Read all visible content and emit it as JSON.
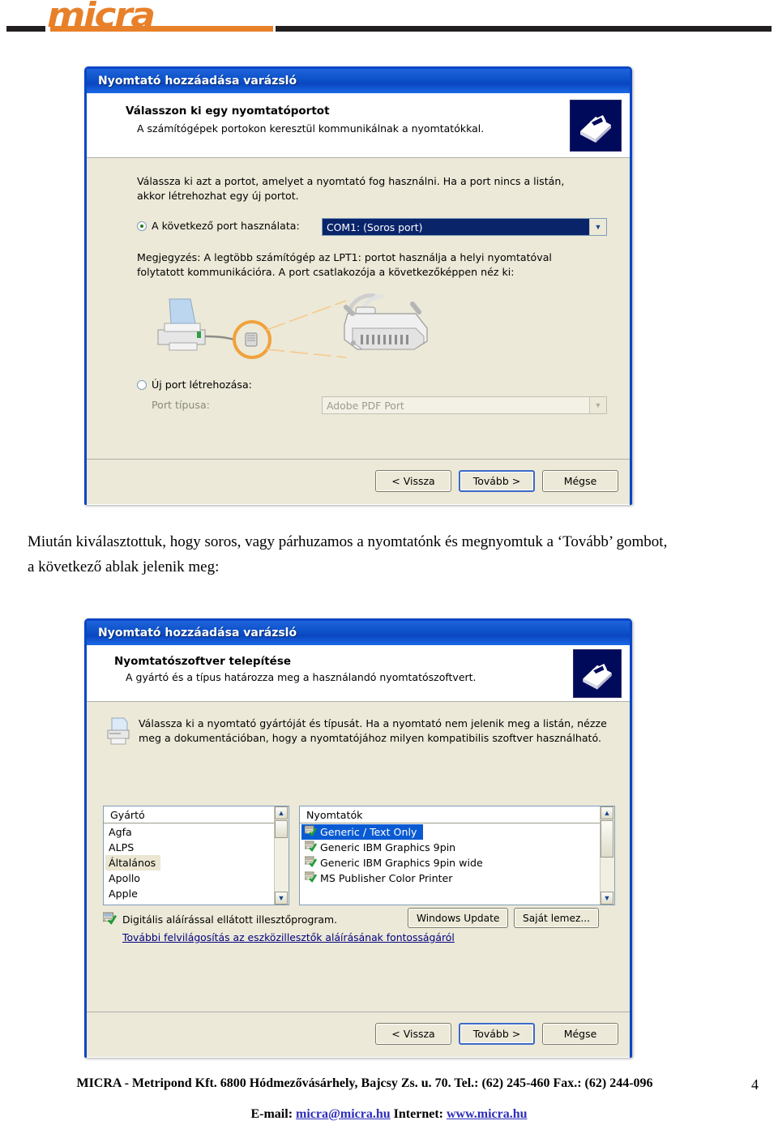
{
  "brand": {
    "logo_text": "micra"
  },
  "dialog1": {
    "title": "Nyomtató hozzáadása varázsló",
    "banner": {
      "heading": "Válasszon ki egy nyomtatóportot",
      "subtitle": "A számítógépek portokon keresztül kommunikálnak a nyomtatókkal.",
      "icon": "printer-wizard-icon"
    },
    "instruction_line1": "Válassza ki azt a portot, amelyet a nyomtató fog használni. Ha a port nincs a listán,",
    "instruction_line2": "akkor létrehozhat egy új portot.",
    "use_port_radio": {
      "label": "A következő port használata:",
      "checked": true
    },
    "port_combo": {
      "value": "COM1: (Soros port)",
      "selected": true
    },
    "note_line1": "Megjegyzés: A legtöbb számítógép az LPT1: portot használja a helyi nyomtatóval",
    "note_line2": "folytatott kommunikációra. A port csatlakozója a következőképpen néz ki:",
    "illustration": "printer-cable-connector-illustration",
    "new_port_radio": {
      "label": "Új port létrehozása:",
      "checked": false
    },
    "port_type_label": "Port típusa:",
    "port_type_combo": {
      "value": "Adobe PDF Port",
      "disabled": true
    },
    "buttons": {
      "back": "< Vissza",
      "next": "Tovább >",
      "cancel": "Mégse"
    }
  },
  "narrative": {
    "line1": "Miután kiválasztottuk, hogy soros, vagy párhuzamos a nyomtatónk és megnyomtuk a ‘Tovább’ gombot,",
    "line2": "a következő ablak jelenik meg:"
  },
  "dialog2": {
    "title": "Nyomtató hozzáadása varázsló",
    "banner": {
      "heading": "Nyomtatószoftver telepítése",
      "subtitle": "A gyártó és a típus határozza meg a használandó nyomtatószoftvert.",
      "icon": "printer-wizard-icon"
    },
    "instruction_icon": "printer-icon",
    "instruction_line1": "Válassza ki a nyomtató gyártóját és típusát. Ha a nyomtató nem jelenik meg a listán, nézze",
    "instruction_line2": "meg a dokumentációban, hogy a nyomtatójához milyen kompatibilis szoftver használható.",
    "manufacturer_list": {
      "header": "Gyártó",
      "items": [
        {
          "label": "Agfa",
          "state": "normal"
        },
        {
          "label": "ALPS",
          "state": "normal"
        },
        {
          "label": "Általános",
          "state": "soft-selected"
        },
        {
          "label": "Apollo",
          "state": "normal"
        },
        {
          "label": "Apple",
          "state": "normal"
        }
      ]
    },
    "printer_list": {
      "header": "Nyomtatók",
      "items": [
        {
          "label": "Generic / Text Only",
          "state": "selected"
        },
        {
          "label": "Generic IBM Graphics 9pin",
          "state": "normal"
        },
        {
          "label": "Generic IBM Graphics 9pin wide",
          "state": "normal"
        },
        {
          "label": "MS Publisher Color Printer",
          "state": "normal"
        }
      ]
    },
    "signed_driver_note": "Digitális aláírással ellátott illesztőprogram.",
    "signed_driver_link": "További felvilágosítás az eszközillesztők aláírásának fontosságáról",
    "windows_update_button": "Windows Update",
    "own_disk_button": "Saját lemez...",
    "buttons": {
      "back": "< Vissza",
      "next": "Tovább >",
      "cancel": "Mégse"
    }
  },
  "footer": {
    "company_line": "MICRA - Metripond Kft. 6800 Hódmezővásárhely, Bajcsy Zs. u. 70. Tel.: (62) 245-460 Fax.: (62) 244-096",
    "email_label": "E-mail:",
    "email": "micra@micra.hu",
    "internet_label": "Internet:",
    "website": "www.micra.hu",
    "page_number": "4"
  },
  "colors": {
    "brand_orange": "#E8802A",
    "dialog_border_blue": "#0A46C8",
    "dialog_face": "#ECE9D8",
    "selection_blue": "#0A5BD3",
    "link_blue": "#000080"
  }
}
